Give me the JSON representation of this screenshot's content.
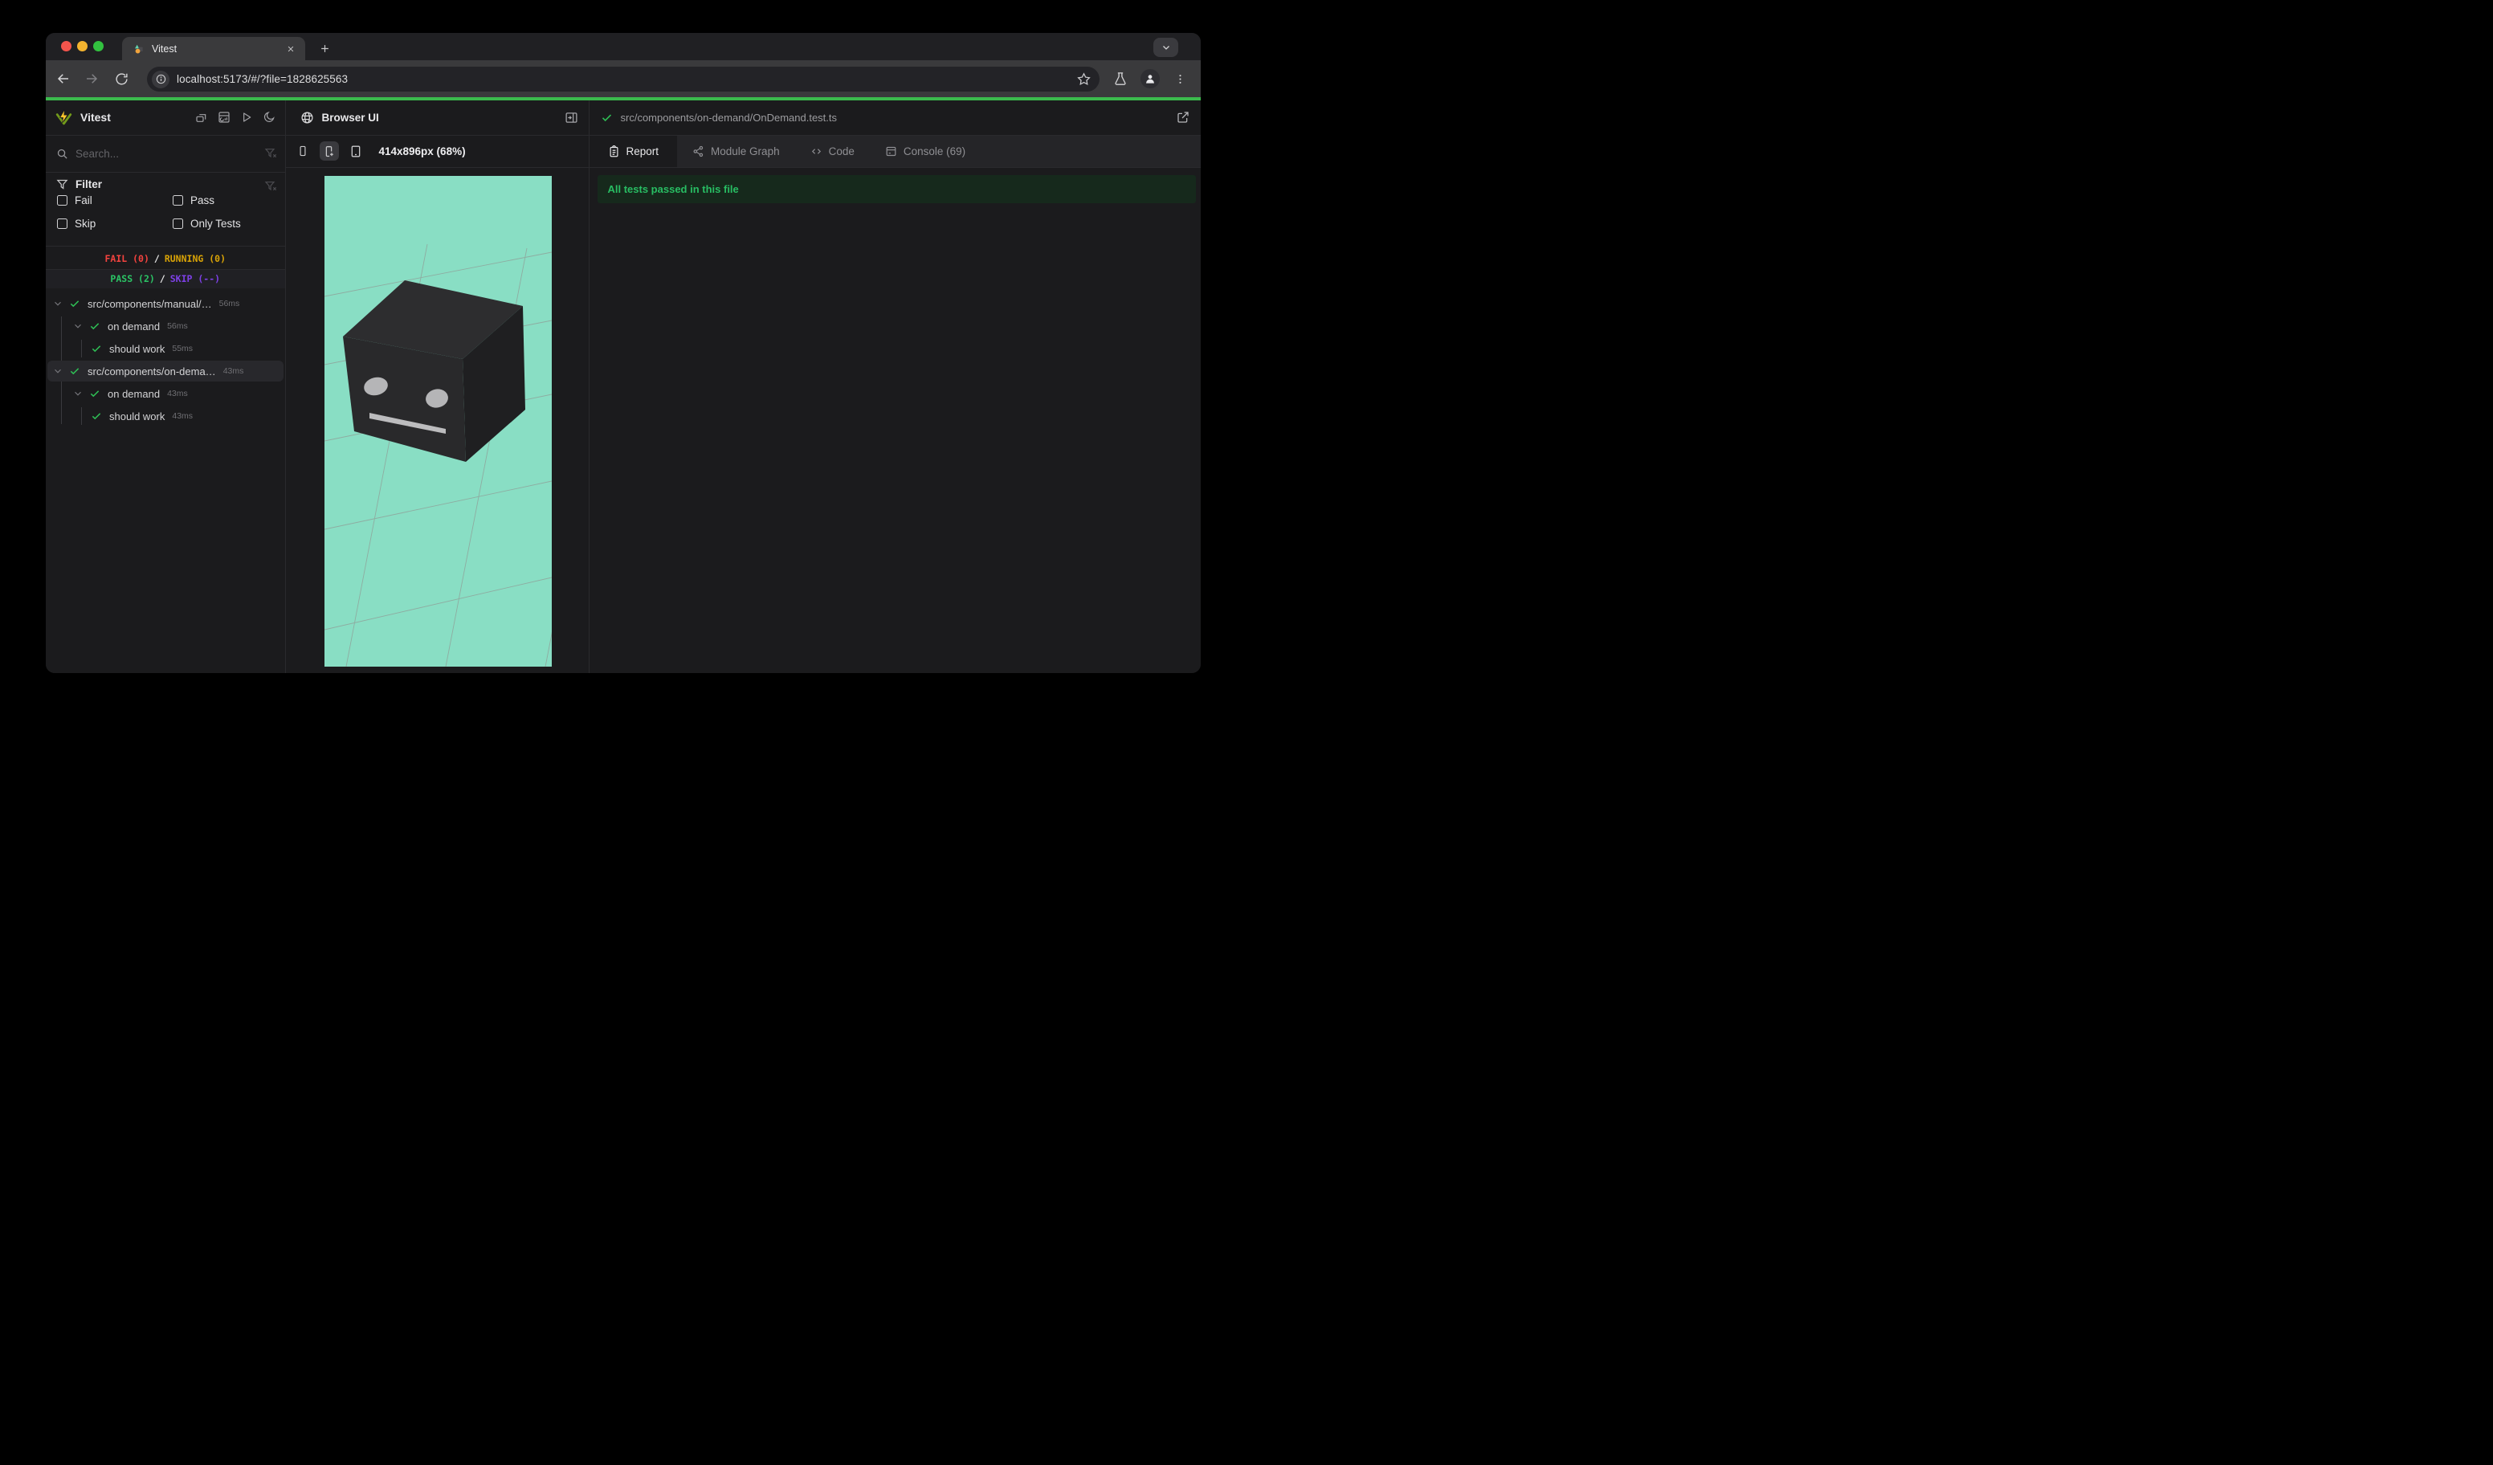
{
  "browser": {
    "tab_title": "Vitest",
    "url": "localhost:5173/#/?file=1828625563"
  },
  "sidebar": {
    "title": "Vitest",
    "search_placeholder": "Search...",
    "filter": {
      "label": "Filter",
      "items": [
        {
          "label": "Fail"
        },
        {
          "label": "Pass"
        },
        {
          "label": "Skip"
        },
        {
          "label": "Only Tests"
        }
      ]
    },
    "status": {
      "fail": "FAIL (0)",
      "sep": "/",
      "running": "RUNNING (0)",
      "pass": "PASS (2)",
      "skip": "SKIP (--)"
    },
    "tree": {
      "rows": [
        {
          "label": "src/components/manual/…",
          "time": "56ms"
        },
        {
          "label": "on demand",
          "time": "56ms"
        },
        {
          "label": "should work",
          "time": "55ms"
        },
        {
          "label": "src/components/on-dema…",
          "time": "43ms"
        },
        {
          "label": "on demand",
          "time": "43ms"
        },
        {
          "label": "should work",
          "time": "43ms"
        }
      ]
    }
  },
  "browser_panel": {
    "title": "Browser UI",
    "viewport_label": "414x896px (68%)"
  },
  "report_panel": {
    "file_path": "src/components/on-demand/OnDemand.test.ts",
    "tabs": [
      {
        "label": "Report"
      },
      {
        "label": "Module Graph"
      },
      {
        "label": "Code"
      },
      {
        "label": "Console (69)"
      }
    ],
    "banner": "All tests passed in this file"
  }
}
